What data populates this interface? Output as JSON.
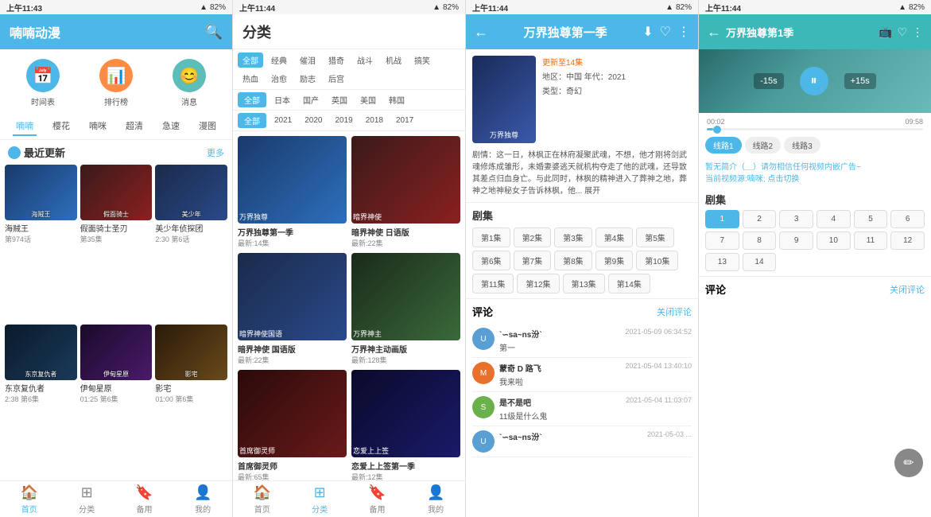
{
  "panels": {
    "panel1": {
      "statusBar": {
        "time": "上午11:43",
        "battery": "82%"
      },
      "header": {
        "title": "喃喃动漫"
      },
      "icons": [
        {
          "id": "schedule",
          "label": "时间表",
          "color": "ic-blue",
          "symbol": "📅"
        },
        {
          "id": "ranking",
          "label": "排行榜",
          "color": "ic-orange",
          "symbol": "📊"
        },
        {
          "id": "news",
          "label": "消息",
          "color": "ic-teal",
          "symbol": "😊"
        }
      ],
      "tabs": [
        {
          "id": "nannan",
          "label": "喃喃",
          "active": true
        },
        {
          "id": "sakura",
          "label": "樱花"
        },
        {
          "id": "whisper",
          "label": "喃咪"
        },
        {
          "id": "ultrahd",
          "label": "超清"
        },
        {
          "id": "fast",
          "label": "急速"
        },
        {
          "id": "comic",
          "label": "漫图"
        }
      ],
      "sectionTitle": "最近更新",
      "sectionMore": "更多",
      "cards": [
        {
          "id": 1,
          "title": "海贼王",
          "sub": "第974话",
          "bg": "bg-c1"
        },
        {
          "id": 2,
          "title": "假面骑士圣刃",
          "sub": "第35集",
          "bg": "bg-c2"
        },
        {
          "id": 3,
          "title": "美少年侦探团",
          "sub": "2:30 第6话",
          "bg": "bg-c3"
        },
        {
          "id": 4,
          "title": "东京复仇者",
          "sub": "2:38 第6集",
          "bg": "bg-c4"
        },
        {
          "id": 5,
          "title": "伊甸星原",
          "sub": "01:25 第6集",
          "bg": "bg-c5"
        },
        {
          "id": 6,
          "title": "影宅",
          "sub": "01:00 第6集",
          "bg": "bg-c6"
        }
      ],
      "bottomNav": [
        {
          "id": "home",
          "label": "首页",
          "icon": "🏠",
          "active": true
        },
        {
          "id": "category",
          "label": "分类",
          "icon": "⊞",
          "active": false
        },
        {
          "id": "tools",
          "label": "备用",
          "icon": "🔖",
          "active": false
        },
        {
          "id": "mine",
          "label": "我的",
          "icon": "👤",
          "active": false
        }
      ]
    },
    "panel2": {
      "statusBar": {
        "time": "上午11:44",
        "battery": "82%"
      },
      "header": {
        "title": "分类"
      },
      "filterRow1": [
        "全部",
        "经典",
        "催泪",
        "猎奇",
        "战斗",
        "机战",
        "搞笑",
        "热血",
        "治愈",
        "励志",
        "后宫"
      ],
      "filterRow2": [
        "全部",
        "日本",
        "国产",
        "英国",
        "美国",
        "韩国"
      ],
      "filterRow3": [
        "全部",
        "2021",
        "2020",
        "2019",
        "2018",
        "2017"
      ],
      "cards": [
        {
          "id": 1,
          "title": "万界独尊第一季",
          "sub": "最新:14集",
          "bg": "bg-c1"
        },
        {
          "id": 2,
          "title": "暗界神使 日语版",
          "sub": "最新:22集",
          "bg": "bg-c2"
        },
        {
          "id": 3,
          "title": "暗界神使 国语版",
          "sub": "最新:22集",
          "bg": "bg-c3"
        },
        {
          "id": 4,
          "title": "万界神主动画版",
          "sub": "最新:128集",
          "bg": "bg-c7"
        },
        {
          "id": 5,
          "title": "首席御灵师",
          "sub": "最新:65集",
          "bg": "bg-c8"
        },
        {
          "id": 6,
          "title": "恋爱上上签第一季",
          "sub": "最新:12集",
          "bg": "bg-c9"
        }
      ],
      "bottomNav": [
        {
          "id": "home",
          "label": "首页",
          "icon": "🏠",
          "active": false
        },
        {
          "id": "category",
          "label": "分类",
          "icon": "⊞",
          "active": true
        },
        {
          "id": "tools",
          "label": "备用",
          "icon": "🔖",
          "active": false
        },
        {
          "id": "mine",
          "label": "我的",
          "icon": "👤",
          "active": false
        }
      ]
    },
    "panel3": {
      "statusBar": {
        "time": "上午11:44",
        "battery": "82%"
      },
      "header": {
        "title": "万界独尊第一季"
      },
      "heroInfo": {
        "update": "更新至14集",
        "region": "地区：中国 年代：2021",
        "type": "类型：奇幻"
      },
      "description": "剧情：这一日，林枫正在林府凝聚武魂，不想，他才刚将剑武魂修炼成雏形，未婚妻婆逃天就机构夺走了他的武魂，还导致其差点归血身亡。与此同时，林枫的精神进入了葬神之地，葬神之地神秘女子告诉林枫，他... 展开",
      "episodesTitle": "剧集",
      "episodes": [
        "第1集",
        "第2集",
        "第3集",
        "第4集",
        "第5集",
        "第6集",
        "第7集",
        "第8集",
        "第9集",
        "第10集",
        "第11集",
        "第12集",
        "第13集",
        "第14集"
      ],
      "commentsTitle": "评论",
      "commentsClose": "关闭评论",
      "comments": [
        {
          "id": 1,
          "user": "`∽sa~ns汾`",
          "time": "2021-05-09 06:34:52",
          "text": "第一",
          "bg": "#5a9fd4"
        },
        {
          "id": 2,
          "user": "蒙奇 D 路飞",
          "time": "2021-05-04 13:40:10",
          "text": "我来啦",
          "bg": "#e8702a"
        },
        {
          "id": 3,
          "user": "是不是吧",
          "time": "2021-05-04 11:03:07",
          "text": "11级是什么鬼",
          "bg": "#6ab04c"
        },
        {
          "id": 4,
          "user": "`∽sa~ns汾`",
          "time": "2021-05-03 ...",
          "text": "",
          "bg": "#5a9fd4"
        }
      ]
    },
    "panel4": {
      "statusBar": {
        "time": "上午11:44",
        "battery": "82%"
      },
      "header": {
        "title": "万界独尊第1季"
      },
      "videoControls": {
        "rewind": "-15s",
        "play": "⏸",
        "forward": "+15s"
      },
      "progressCurrent": "00:02",
      "progressTotal": "09:58",
      "sourceTabs": [
        "线路1",
        "线路2",
        "线路3"
      ],
      "notice": "暂无简介（＿）请勿相信任何视频内嵌广告~",
      "switchLabel": "当前视频源:喃咪; 点击切换",
      "episodesTitle": "剧集",
      "episodes": [
        "1",
        "2",
        "3",
        "4",
        "5",
        "6",
        "7",
        "8",
        "9",
        "10",
        "11",
        "12",
        "13",
        "14"
      ],
      "commentsTitle": "评论",
      "commentsClose": "关闭评论"
    }
  }
}
